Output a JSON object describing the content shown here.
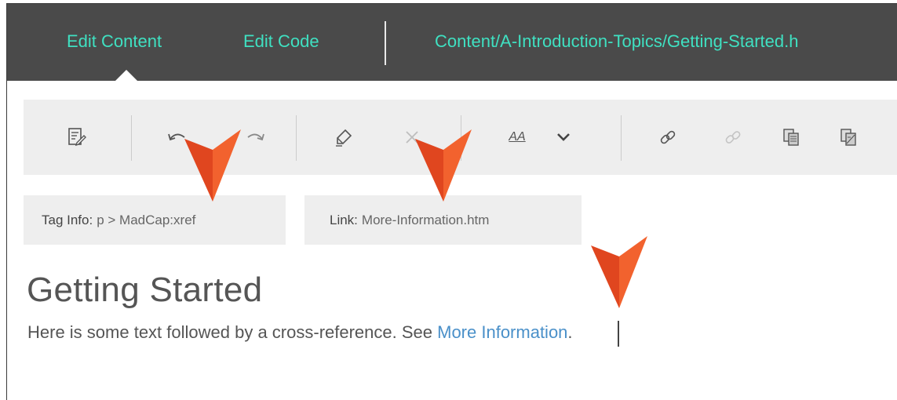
{
  "tabs": {
    "edit_content": "Edit Content",
    "edit_code": "Edit Code"
  },
  "file_path": "Content/A-Introduction-Topics/Getting-Started.h",
  "toolbar": {
    "icons": [
      "edit-document-icon",
      "undo-icon",
      "redo-icon",
      "eraser-icon",
      "clear-x-icon",
      "text-size-icon",
      "chevron-down-icon",
      "link-icon",
      "unlink-icon",
      "copy-icon",
      "paste-icon"
    ],
    "text_size_label": "AA"
  },
  "tag_info": {
    "label": "Tag Info:",
    "value": "p > MadCap:xref"
  },
  "link_info": {
    "label": "Link:",
    "value": "More-Information.htm"
  },
  "content": {
    "title": "Getting Started",
    "body_text": "Here is some text followed by a cross-reference. See ",
    "xref_text": "More Information",
    "trailing": "."
  },
  "colors": {
    "topbar_bg": "#4a4a4a",
    "tab_text": "#3fe0c1",
    "toolbar_bg": "#eeeeee",
    "link": "#4a90c9",
    "arrow_orange": "#e8552a"
  }
}
